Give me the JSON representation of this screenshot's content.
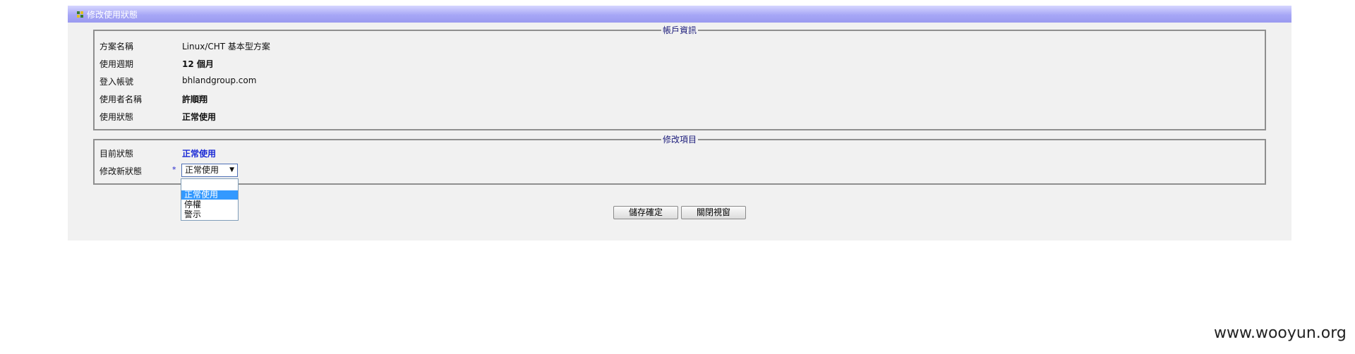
{
  "window": {
    "title": "修改使用狀態"
  },
  "account_info": {
    "legend": "帳戶資訊",
    "rows": [
      {
        "label": "方案名稱",
        "value": "Linux/CHT 基本型方案"
      },
      {
        "label": "使用週期",
        "value": "12 個月"
      },
      {
        "label": "登入帳號",
        "value": "bhlandgroup.com"
      },
      {
        "label": "使用者名稱",
        "value": "許順翔"
      },
      {
        "label": "使用狀態",
        "value": "正常使用"
      }
    ]
  },
  "edit_section": {
    "legend": "修改項目",
    "current_status_label": "目前狀態",
    "current_status_value": "正常使用",
    "new_status_label": "修改新狀態",
    "required_mark": "*",
    "select_value": "正常使用",
    "options": [
      "正常使用",
      "停權",
      "警示"
    ],
    "selected_option": "正常使用"
  },
  "buttons": {
    "save": "儲存確定",
    "close": "關閉視窗"
  },
  "watermark": "www.wooyun.org",
  "colors": {
    "title_gradient": "#a7a7f6",
    "status_blue": "#1a2ad6",
    "selection": "#3399ff"
  }
}
